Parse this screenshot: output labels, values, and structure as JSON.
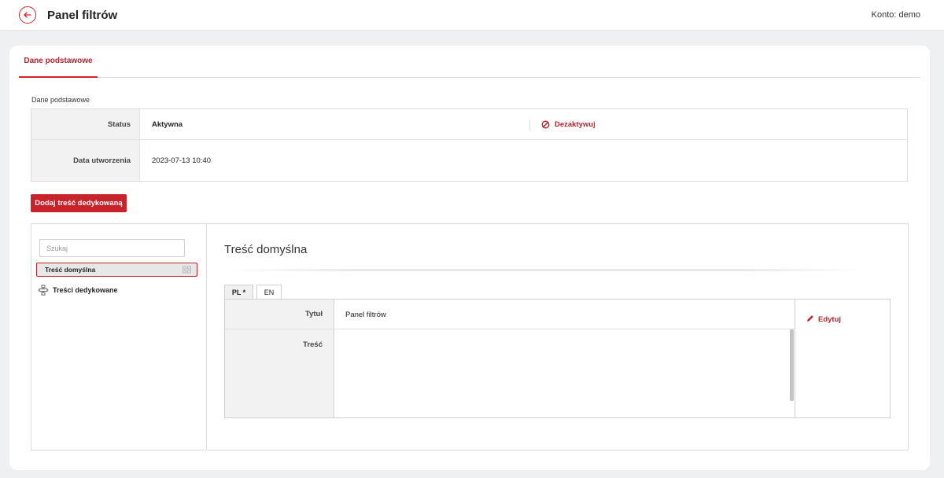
{
  "header": {
    "title": "Panel filtrów",
    "account": "Konto: demo"
  },
  "tabs": [
    {
      "label": "Dane podstawowe",
      "active": true
    }
  ],
  "basic_section": {
    "caption": "Dane podstawowe",
    "status_label": "Status",
    "status_value": "Aktywna",
    "deactivate_label": "Dezaktywuj",
    "created_label": "Data utworzenia",
    "created_value": "2023-07-13 10:40"
  },
  "add_button_label": "Dodaj treść dedykowaną",
  "tree": {
    "search_placeholder": "Szukaj",
    "items": [
      {
        "label": "Treść domyślna",
        "selected": true
      },
      {
        "label": "Treści dedykowane",
        "selected": false
      }
    ]
  },
  "content": {
    "title": "Treść domyślna",
    "languages": [
      {
        "label": "PL *",
        "active": true
      },
      {
        "label": "EN",
        "active": false
      }
    ],
    "fields": [
      {
        "label": "Tytuł",
        "value": "Panel filtrów"
      },
      {
        "label": "Treść",
        "value": ""
      }
    ],
    "edit_label": "Edytuj"
  },
  "colors": {
    "accent": "#c8222b",
    "background": "#eef0f2",
    "label_bg": "#f2f2f2"
  },
  "icons": {
    "back": "arrow-left-icon",
    "deactivate": "ban-icon",
    "drag": "drag-handle-icon",
    "tree_group": "tree-node-icon",
    "edit": "pencil-icon"
  }
}
